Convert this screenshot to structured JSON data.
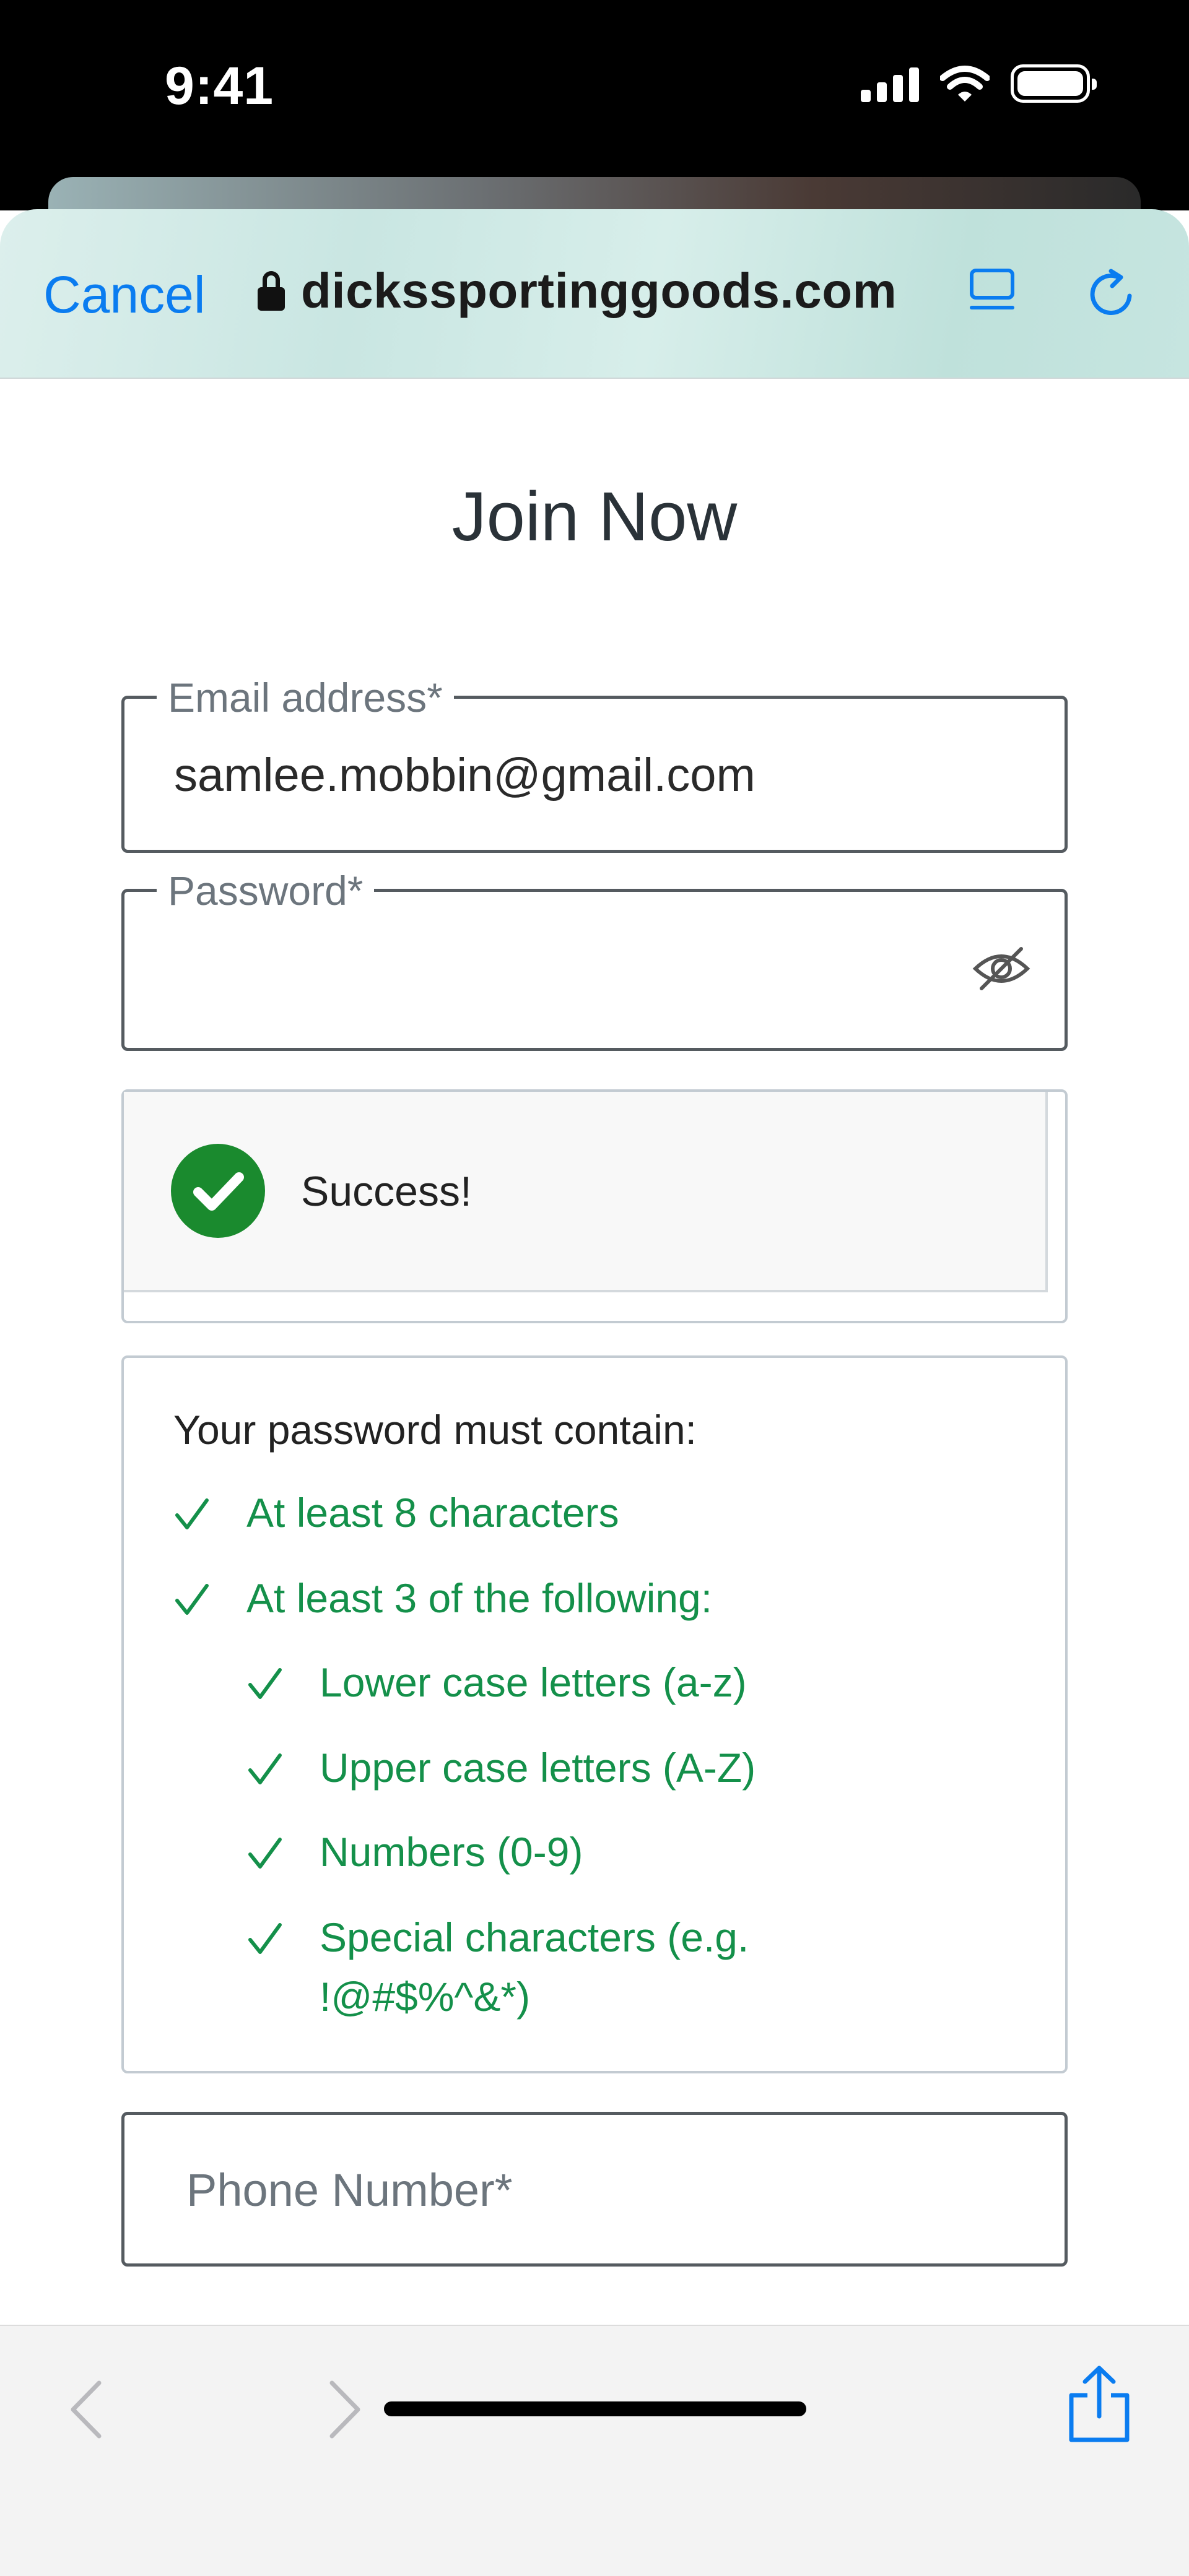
{
  "status_bar": {
    "time": "9:41"
  },
  "browser": {
    "cancel_label": "Cancel",
    "url": "dickssportinggoods.com"
  },
  "page": {
    "title": "Join Now",
    "email": {
      "label": "Email address*",
      "value": "samlee.mobbin@gmail.com"
    },
    "password": {
      "label": "Password*",
      "value": ""
    },
    "success": {
      "message": "Success!"
    },
    "rules": {
      "title": "Your password must contain:",
      "items": [
        {
          "text": "At least 8 characters",
          "met": true
        },
        {
          "text": "At least 3 of the following:",
          "met": true
        },
        {
          "text": "Lower case letters (a-z)",
          "met": true
        },
        {
          "text": "Upper case letters (A-Z)",
          "met": true
        },
        {
          "text": "Numbers (0-9)",
          "met": true
        },
        {
          "text": "Special characters (e.g. !@#$%^&*)",
          "met": true
        }
      ]
    },
    "phone": {
      "placeholder": "Phone Number*",
      "value": ""
    }
  },
  "colors": {
    "accent": "#0a7cf0",
    "success": "#1a8a2e",
    "rule_met": "#14904a"
  },
  "icons": [
    "lock-icon",
    "reader-icon",
    "reload-icon",
    "eye-slash-icon",
    "check-circle-icon",
    "checkmark-icon",
    "back-arrow-icon",
    "forward-arrow-icon",
    "share-icon"
  ]
}
